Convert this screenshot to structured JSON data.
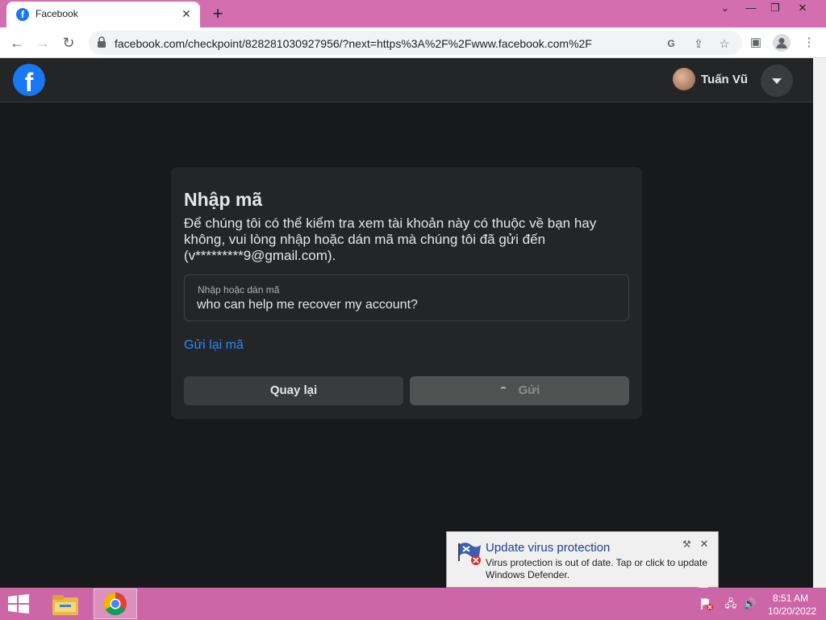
{
  "browser": {
    "tab_title": "Facebook",
    "tab_favicon": "f",
    "close_glyph": "✕",
    "newtab_glyph": "+",
    "url": "facebook.com/checkpoint/828281030927956/?next=https%3A%2F%2Fwww.facebook.com%2F",
    "window_controls": {
      "chevron": "⌄",
      "minimize": "—",
      "restore": "❐",
      "close": "✕"
    },
    "nav": {
      "back": "←",
      "forward": "→",
      "reload": "↻"
    },
    "toolbar_icons": {
      "translate": "G",
      "share": "⇪",
      "bookmark": "☆",
      "side_panel": "▣",
      "menu": "⋮"
    }
  },
  "header": {
    "logo_letter": "f",
    "user_name": "Tuấn Vũ"
  },
  "card": {
    "title": "Nhập mã",
    "description": "Để chúng tôi có thể kiểm tra xem tài khoản này có thuộc về bạn hay không, vui lòng nhập hoặc dán mã mà chúng tôi đã gửi đến (v*********9@gmail.com).",
    "field_label": "Nhập hoặc dán mã",
    "field_value": "who can help me recover my account?",
    "resend_link": "Gửi lại mã",
    "back_button": "Quay lại",
    "send_button": "Gửi"
  },
  "notification": {
    "title": "Update virus protection",
    "message": "Virus protection is out of date. Tap or click to update Windows Defender.",
    "tools_glyph": "⚒",
    "close_glyph": "✕"
  },
  "taskbar": {
    "time": "8:51 AM",
    "date": "10/20/2022",
    "icons": [
      "windows-start-icon",
      "file-explorer-icon",
      "chrome-icon",
      "defender-alert-icon",
      "network-icon",
      "volume-icon"
    ],
    "tray": {
      "network": "🖧",
      "volume": "🔊"
    }
  },
  "colors": {
    "accent": "#1877f2",
    "link": "#2d88ff",
    "page_bg": "#18191a",
    "card_bg": "#242526",
    "titlebar": "#d36fae",
    "taskbar": "#cd66a6"
  }
}
